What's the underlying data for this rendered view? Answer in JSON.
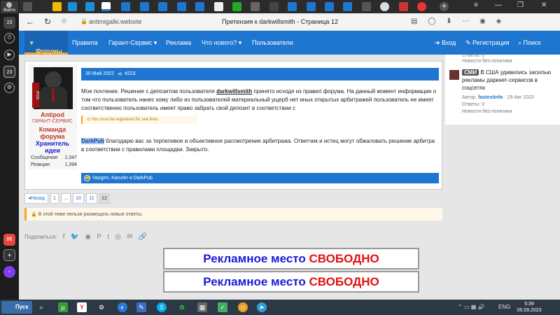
{
  "browser": {
    "login_label": "Войти",
    "tab_count": "23",
    "url": "antimigalki.website",
    "page_title": "Претензия к darkwillsmith - Страница 12",
    "sidebar_counter": "23"
  },
  "site_nav": {
    "items": [
      "Форумы",
      "Правила",
      "Гарант-Сервис",
      "Реклама",
      "Что нового?",
      "Пользователи"
    ],
    "login": "Вход",
    "register": "Регистрация",
    "search": "Поиск"
  },
  "news": {
    "prev_meta": "Ответы: 0",
    "prev_category": "Новости без политики",
    "badge": "СМИ",
    "headline": "В США удивились засилью рекламы даркнет-сервисов в соцсетях",
    "author_label": "Автор:",
    "author": "fastestinfo",
    "date": "· 29 Авг 2023 ·",
    "replies": "Ответы: 0",
    "category": "Новости без политики"
  },
  "post": {
    "date": "30 Май 2022",
    "number": "#223",
    "user": {
      "name": "Antipod",
      "role": "ГАРАНТ-СЕРВИС",
      "banner1": "Команда форума",
      "banner2": "Хранитель идеи",
      "messages_label": "Сообщения",
      "messages": "2,347",
      "reactions_label": "Реакции",
      "reactions": "1,394",
      "avatar_tag": "IPOD"
    },
    "body_before": "Мое почтение. Решение с депозитом пользователя ",
    "quoted_user": "darkwillsmith",
    "body_after": " принято исходя из правил форума. На данный момент информации о том что пользователь нанес кому либо из пользователей материальный ущерб нет иных открытых арбитражей пользователь не имеет соответственно пользователь имеет право забрать свой депозит в соответствии с",
    "reg_notice": "You must be registered for see links",
    "reply_mention": "DarkPub",
    "reply_text": " благодарю вас за терпеливое и объективное рассмотрение арбитража. Ответчик и истец могут обжаловать решение арбитра в соответствии с правилами площадки. Закрыто.",
    "likes": "Vazgen, Kanzler и DarkPub"
  },
  "pager": [
    "◂Назад",
    "1",
    "…",
    "10",
    "11",
    "12"
  ],
  "closed_notice": "В этой теме нельзя размещать новые ответы.",
  "share_label": "Поделиться:",
  "ads": [
    {
      "part1": "Рекламное место ",
      "part2": "СВОБОДНО"
    },
    {
      "part1": "Рекламное место ",
      "part2": "СВОБОДНО"
    }
  ],
  "taskbar": {
    "start": "Пуск",
    "lang": "ENG",
    "time": "5:39",
    "date": "05.09.2023"
  },
  "colors": {
    "brand_blue": "#1e76d0",
    "accent_orange": "#f5a623",
    "ad_blue": "#1a1ad6",
    "ad_red": "#e01010"
  }
}
